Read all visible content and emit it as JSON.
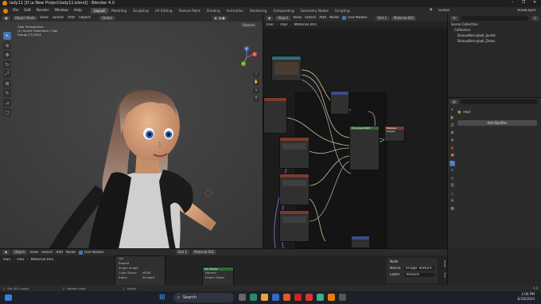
{
  "app": {
    "title": "lady11 [D:\\a New Project\\lady11.blend] - Blender 4.0",
    "window_controls": [
      "–",
      "❐",
      "✕"
    ]
  },
  "menu": {
    "items": [
      "File",
      "Edit",
      "Render",
      "Window",
      "Help"
    ],
    "workspaces": [
      "Layout",
      "Modeling",
      "Sculpting",
      "UV Editing",
      "Texture Paint",
      "Shading",
      "Animation",
      "Rendering",
      "Compositing",
      "Geometry Nodes",
      "Scripting"
    ],
    "active_workspace": "Layout",
    "scene_label": "Scene",
    "viewlayer_label": "ViewLayer"
  },
  "viewport": {
    "header": {
      "mode": "Object Mode",
      "items": [
        "View",
        "Select",
        "Add",
        "Object"
      ],
      "transform": "Global",
      "options": "Options"
    },
    "info": {
      "line1": "User Perspective",
      "line2": "(1) Scene Collection | Hair",
      "line3": "Sampl 27/1024"
    },
    "gizmo_axes": [
      "X",
      "Y",
      "Z"
    ]
  },
  "node_editor": {
    "header": {
      "type": "Object",
      "items": [
        "View",
        "Select",
        "Add",
        "Node"
      ],
      "use_nodes_label": "Use Nodes",
      "slot": "Slot 1",
      "material": "Material.001"
    },
    "breadcrumb": [
      "Hair",
      "Hair",
      "Material.001"
    ],
    "frame_label": "Textures",
    "output_node": "Material Output",
    "bsdf_node": "Principled BSDF"
  },
  "outliner": {
    "root": "Scene Collection",
    "items": [
      "Collection",
      "DeluxeBernyball_Jacket",
      "DeluxeBernyball_Dress"
    ]
  },
  "properties": {
    "object_name": "Hair",
    "add_modifier_label": "Add Modifier"
  },
  "bottom_editor": {
    "header": {
      "type": "Object",
      "items": [
        "View",
        "Select",
        "Add",
        "Node"
      ],
      "use_nodes_label": "Use Nodes",
      "slot": "Slot 1",
      "material": "Material.001"
    },
    "breadcrumb": [
      "Hair",
      "Hair",
      "Material.001"
    ],
    "fields": [
      "Lat",
      "Repeat",
      "Single Image",
      "Color Space",
      "Alpha"
    ],
    "field_values": [
      "",
      "",
      "",
      "sRGB",
      "Straight"
    ],
    "mix_node": "Mix Shader",
    "mix_field": "Normal",
    "smart_label": "Smart Guess",
    "npanel": {
      "title": "Node",
      "name_label": "Name",
      "name_value": "Image Texture.",
      "label_label": "Label",
      "label_value": "Texture"
    },
    "side_tabs": [
      "Node",
      "Tool"
    ]
  },
  "statusbar": {
    "left": "Set 3D Cursor",
    "mid": "Rotate View",
    "right": "Select",
    "version": "4.0"
  },
  "taskbar": {
    "search_placeholder": "Search",
    "time": "1:06 PM",
    "date": "6/18/2024"
  },
  "colors": {
    "accent": "#4772b3",
    "node_teal": "#2c6e73",
    "node_red": "#7a3b2c",
    "node_green": "#2f6b3a",
    "node_blue": "#3a4d8a"
  }
}
